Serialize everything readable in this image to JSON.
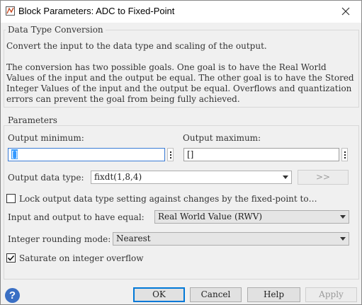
{
  "window": {
    "title": "Block Parameters: ADC to Fixed-Point"
  },
  "conversion": {
    "legend": "Data Type Conversion",
    "summary": "Convert the input to the data type and scaling of the output.",
    "details": "The conversion has two possible goals. One goal is to have the Real World Values of the input and the output be equal.  The other goal is to have the Stored Integer Values of the input and the output be equal.  Overflows and quantization errors can prevent the goal from being fully achieved."
  },
  "parameters": {
    "legend": "Parameters",
    "output_min_label": "Output minimum:",
    "output_min_value": "[]",
    "output_max_label": "Output maximum:",
    "output_max_value": "[]",
    "output_type_label": "Output data type:",
    "output_type_value": "fixdt(1,8,4)",
    "assistant_button": ">>",
    "lock_label": "Lock output data type setting against changes by the fixed-point to…",
    "equal_label": "Input and output to have equal:",
    "equal_value": "Real World Value (RWV)",
    "rounding_label": "Integer rounding mode:",
    "rounding_value": "Nearest",
    "saturate_label": "Saturate on integer overflow",
    "saturate_checked": true,
    "lock_checked": false
  },
  "buttons": {
    "ok": "OK",
    "cancel": "Cancel",
    "help": "Help",
    "apply": "Apply",
    "help_icon": "?"
  },
  "colors": {
    "accent": "#0078d7",
    "help_icon": "#3a6fc4"
  }
}
